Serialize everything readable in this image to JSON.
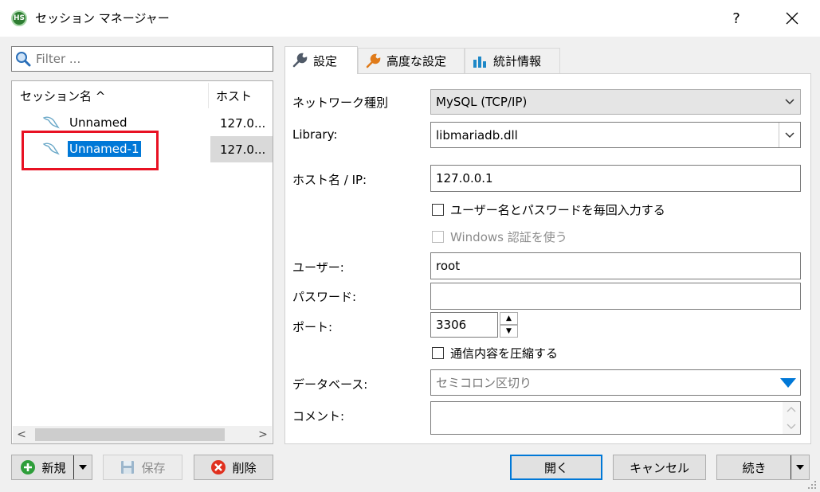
{
  "window": {
    "icon_text": "HS",
    "title": "セッション マネージャー",
    "help": "?"
  },
  "filter": {
    "placeholder": "Filter ..."
  },
  "session_list": {
    "col_name": "セッション名 ^",
    "col_host": "ホスト",
    "rows": [
      {
        "name": "Unnamed",
        "host": "127.0..."
      },
      {
        "name": "Unnamed-1",
        "host": "127.0..."
      }
    ],
    "scroll_left": "<",
    "scroll_right": ">"
  },
  "tabs": [
    {
      "label": "設定",
      "icon": "wrench-icon"
    },
    {
      "label": "高度な設定",
      "icon": "wrench-icon"
    },
    {
      "label": "統計情報",
      "icon": "bar-chart-icon"
    }
  ],
  "settings": {
    "network_type_label": "ネットワーク種別",
    "network_type_value": "MySQL (TCP/IP)",
    "library_label": "Library:",
    "library_value": "libmariadb.dll",
    "hostname_label": "ホスト名 / IP:",
    "hostname_value": "127.0.0.1",
    "prompt_login_label": "ユーザー名とパスワードを毎回入力する",
    "windows_auth_label": "Windows 認証を使う",
    "user_label": "ユーザー:",
    "user_value": "root",
    "password_label": "パスワード:",
    "password_value": "",
    "port_label": "ポート:",
    "port_value": "3306",
    "spin_up": "▲",
    "spin_down": "▼",
    "compress_label": "通信内容を圧縮する",
    "database_label": "データベース:",
    "database_placeholder": "セミコロン区切り",
    "comment_label": "コメント:",
    "comment_value": ""
  },
  "buttons": {
    "new": "新規",
    "save": "保存",
    "delete": "削除",
    "open": "開く",
    "cancel": "キャンセル",
    "more": "続き"
  },
  "colors": {
    "selection": "#0078d7",
    "highlight_box": "#e81123",
    "new_icon": "#2e9e3a",
    "delete_icon": "#e0301e",
    "dropdown_arrow": "#0078d7"
  }
}
